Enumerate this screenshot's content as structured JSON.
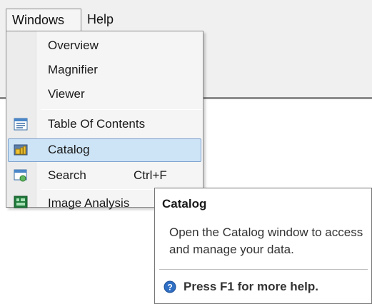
{
  "menubar": {
    "items": [
      {
        "label": "Windows"
      },
      {
        "label": "Help"
      }
    ]
  },
  "windows_menu": {
    "items": [
      {
        "label": "Overview",
        "icon": ""
      },
      {
        "label": "Magnifier",
        "icon": ""
      },
      {
        "label": "Viewer",
        "icon": ""
      },
      {
        "label": "Table Of Contents",
        "icon": "table-of-contents-icon"
      },
      {
        "label": "Catalog",
        "icon": "catalog-icon",
        "highlighted": true
      },
      {
        "label": "Search",
        "shortcut": "Ctrl+F",
        "icon": "search-window-icon"
      },
      {
        "label": "Image Analysis",
        "icon": "image-analysis-icon"
      }
    ]
  },
  "tooltip": {
    "title": "Catalog",
    "body": "Open the Catalog window to access and manage your data.",
    "help_text": "Press F1 for more help.",
    "help_icon": "help-icon"
  },
  "colors": {
    "highlight_fill": "#cde4f7",
    "highlight_border": "#7da2ce",
    "menu_background": "#f5f5f5",
    "help_icon_blue": "#2f6fc4"
  }
}
